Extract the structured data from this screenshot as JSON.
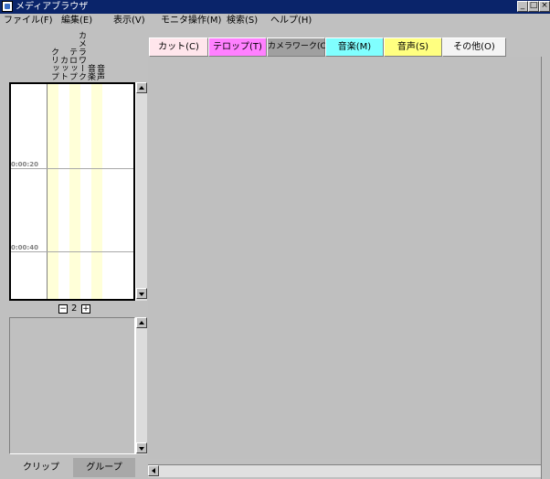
{
  "window": {
    "title": "メディアブラウザ"
  },
  "menu": [
    "ファイル(F)",
    "編集(E)",
    "表示(V)",
    "モニタ操作(M)",
    "検索(S)",
    "ヘルプ(H)"
  ],
  "timeline": {
    "columns": [
      "クリップ",
      "カット",
      "テロップ",
      "カメラワーク",
      "音楽",
      "音声"
    ],
    "time_labels": [
      "0:00:20",
      "0:00:40"
    ],
    "zoom_level": "2",
    "zoom_out": "−",
    "zoom_in": "+"
  },
  "bottom_tabs": [
    "クリップ",
    "グループ"
  ],
  "category_tabs": [
    {
      "label": "カット(C)",
      "color": "#ffe6ec"
    },
    {
      "label": "テロップ(T)",
      "color": "#ff80ff"
    },
    {
      "label": "カメラワーク(Ca)",
      "color": "#a0a0a0"
    },
    {
      "label": "音楽(M)",
      "color": "#80ffff"
    },
    {
      "label": "音声(S)",
      "color": "#ffff80"
    },
    {
      "label": "その他(O)",
      "color": "#f4f4f4"
    }
  ],
  "colors": {
    "titlebar": "#0a246a",
    "timeline_stripe": "#ffffd8"
  }
}
